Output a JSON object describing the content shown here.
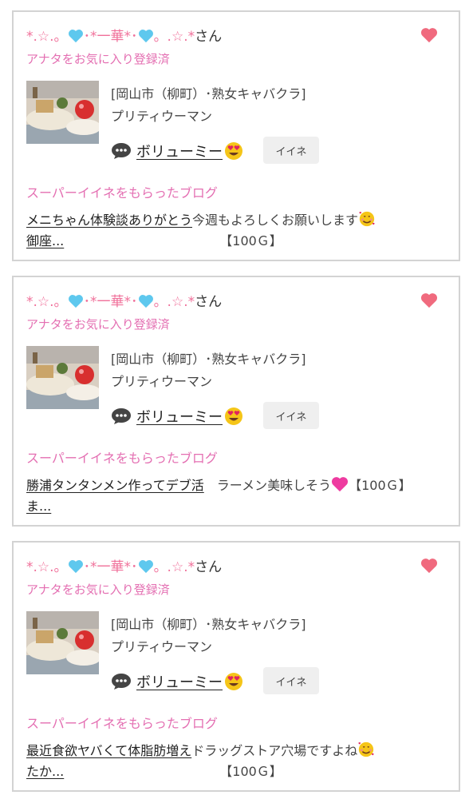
{
  "cards": [
    {
      "user": {
        "prefix": "*.☆.。",
        "mid": "･*一華*･",
        "suffix": "。.☆.*",
        "honorific": "さん"
      },
      "favorite_status": "アナタをお気に入り登録済",
      "shop_area": "[岡山市（柳町）･熟女キャバクラ]",
      "shop_name": "プリティウーマン",
      "cast_name": "ボリューミー",
      "iine_label": "イイネ",
      "super_title": "スーパーイイネをもらったブログ",
      "blog_link_1": "メニちゃん体験談ありがとう",
      "blog_link_2": "御座...",
      "blog_comment": "今週もよろしくお願いします",
      "blog_reward": "【100Ｇ】"
    },
    {
      "user": {
        "prefix": "*.☆.。",
        "mid": "･*一華*･",
        "suffix": "。.☆.*",
        "honorific": "さん"
      },
      "favorite_status": "アナタをお気に入り登録済",
      "shop_area": "[岡山市（柳町）･熟女キャバクラ]",
      "shop_name": "プリティウーマン",
      "cast_name": "ボリューミー",
      "iine_label": "イイネ",
      "super_title": "スーパーイイネをもらったブログ",
      "blog_link_1": "勝浦タンタンメン作ってデブ活",
      "blog_link_2": "ま...",
      "blog_comment": "ラーメン美味しそう",
      "blog_reward": "【100Ｇ】"
    },
    {
      "user": {
        "prefix": "*.☆.。",
        "mid": "･*一華*･",
        "suffix": "。.☆.*",
        "honorific": "さん"
      },
      "favorite_status": "アナタをお気に入り登録済",
      "shop_area": "[岡山市（柳町）･熟女キャバクラ]",
      "shop_name": "プリティウーマン",
      "cast_name": "ボリューミー",
      "iine_label": "イイネ",
      "super_title": "スーパーイイネをもらったブログ",
      "blog_link_1": "最近食欲ヤバくて体脂肪増え",
      "blog_link_2": "たか...",
      "blog_comment": "ドラッグストア穴場ですよね",
      "blog_reward": "【100Ｇ】"
    }
  ],
  "icons": {
    "heart": "heart-icon",
    "user_hearts": "light-blue-heart-icon",
    "chat": "speech-bubble-icon",
    "face": "heart-eyes-face-icon",
    "blog_emoji": [
      "smiling-face-with-hearts-icon",
      "pink-heart-icon",
      "smiling-face-with-hearts-icon"
    ]
  },
  "colors": {
    "accent_pink": "#e46fb2",
    "heart_red": "#f06a7e",
    "light_blue_heart": "#5ec8ee",
    "card_border": "#d3d3d3",
    "button_bg": "#efefef"
  }
}
